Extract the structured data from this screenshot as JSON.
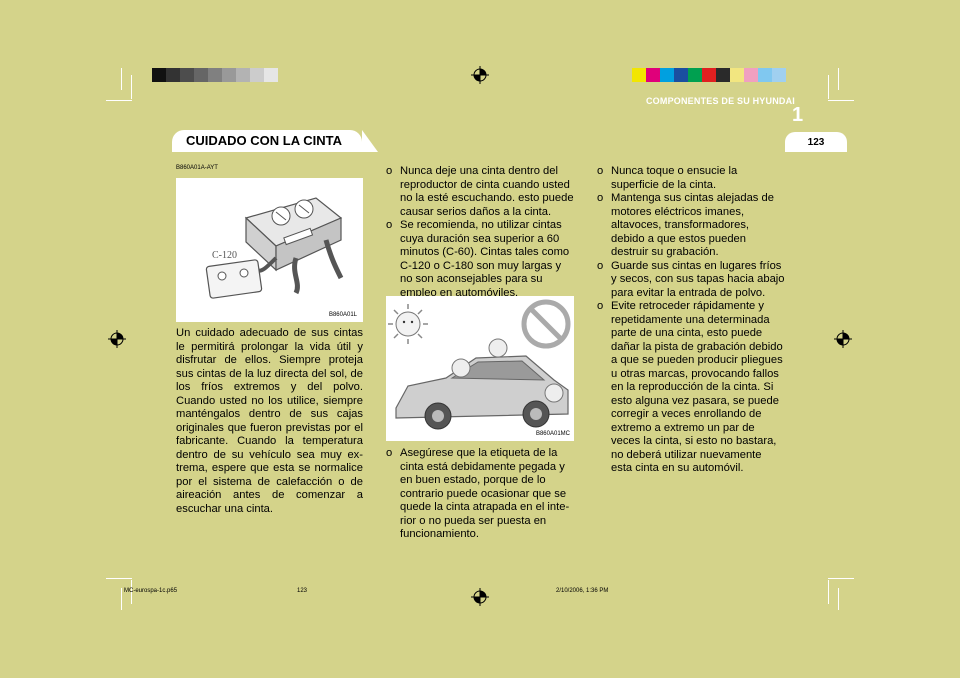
{
  "header": {
    "chapter_title": "COMPONENTES DE SU HYUNDAI",
    "chapter_number": "1",
    "page_number": "123"
  },
  "section": {
    "title": "CUIDADO CON LA CINTA",
    "code": "B860A01A-AYT"
  },
  "figures": {
    "cassette": {
      "code": "B860A01L",
      "label": "C-120",
      "icon": "cassette-illustration"
    },
    "car": {
      "code": "B860A01MC",
      "icon": "car-sun-illustration"
    }
  },
  "column1": {
    "paragraph": "Un cuidado adecuado de sus cintas le permitirá prolongar la vida útil y disfrutar de ellos. Siempre proteja sus cintas de la luz directa del sol, de los fríos extremos y del polvo. Cuando usted no los utilice, siempre manténgalos dentro de sus cajas originales que fueron previstas por el fabricante. Cuando la temperatura dentro de su vehículo sea muy ex-trema, espere que esta se normalice por el sistema de calefacción o de aireación antes de comenzar a escuchar una cinta."
  },
  "column2": {
    "bullet": "o",
    "items_top": [
      "Nunca deje una cinta dentro del reproductor de cinta cuando usted no la esté escuchando. esto puede causar serios daños a la cinta.",
      "Se recomienda, no utilizar cintas cuya duración sea superior a 60 minutos (C-60). Cintas tales como C-120 o C-180 son muy largas y no son aconsejables para su empleo en automóviles."
    ],
    "items_bottom": [
      "Asegúrese que la etiqueta de la cinta está debidamente pegada y en buen estado, porque de lo contrario puede ocasionar que se quede la cinta atrapada en el inte-rior o no pueda ser puesta en funcionamiento."
    ]
  },
  "column3": {
    "items": [
      "Nunca toque o ensucie la superficie de la cinta.",
      "Mantenga sus cintas alejadas de motores eléctricos imanes, altavoces, transformadores, debido a que estos pueden destruir su grabación.",
      "Guarde sus cintas en lugares fríos y secos, con sus tapas hacia abajo para evitar la entrada de polvo.",
      "Evite retroceder rápidamente y repetidamente una determinada parte de una cinta, esto puede dañar la pista de grabación debido a que se pueden producir pliegues u otras marcas, provocando fallos en la reproducción de la cinta. Si esto alguna vez pasara, se puede corregir a veces enrollando de extremo a extremo un par de veces la cinta, si esto no bastara, no deberá utilizar nuevamente esta cinta en su automóvil."
    ]
  },
  "footer": {
    "file": "MC-eurospa-1c.p65",
    "page": "123",
    "date": "2/10/2006, 1:36 PM"
  },
  "colors": {
    "background": "#d4d38a",
    "text": "#000000",
    "gray_bar": [
      "#111111",
      "#333333",
      "#4d4d4d",
      "#666666",
      "#808080",
      "#999999",
      "#b3b3b3",
      "#cccccc",
      "#e6e6e6"
    ],
    "color_bar": [
      "#f2e600",
      "#e0007a",
      "#00a0e0",
      "#1a4fa0",
      "#00a050",
      "#e02020",
      "#2a2a2a",
      "#f2e680",
      "#f0a0c0",
      "#80c8f0",
      "#a0d0f0"
    ]
  }
}
